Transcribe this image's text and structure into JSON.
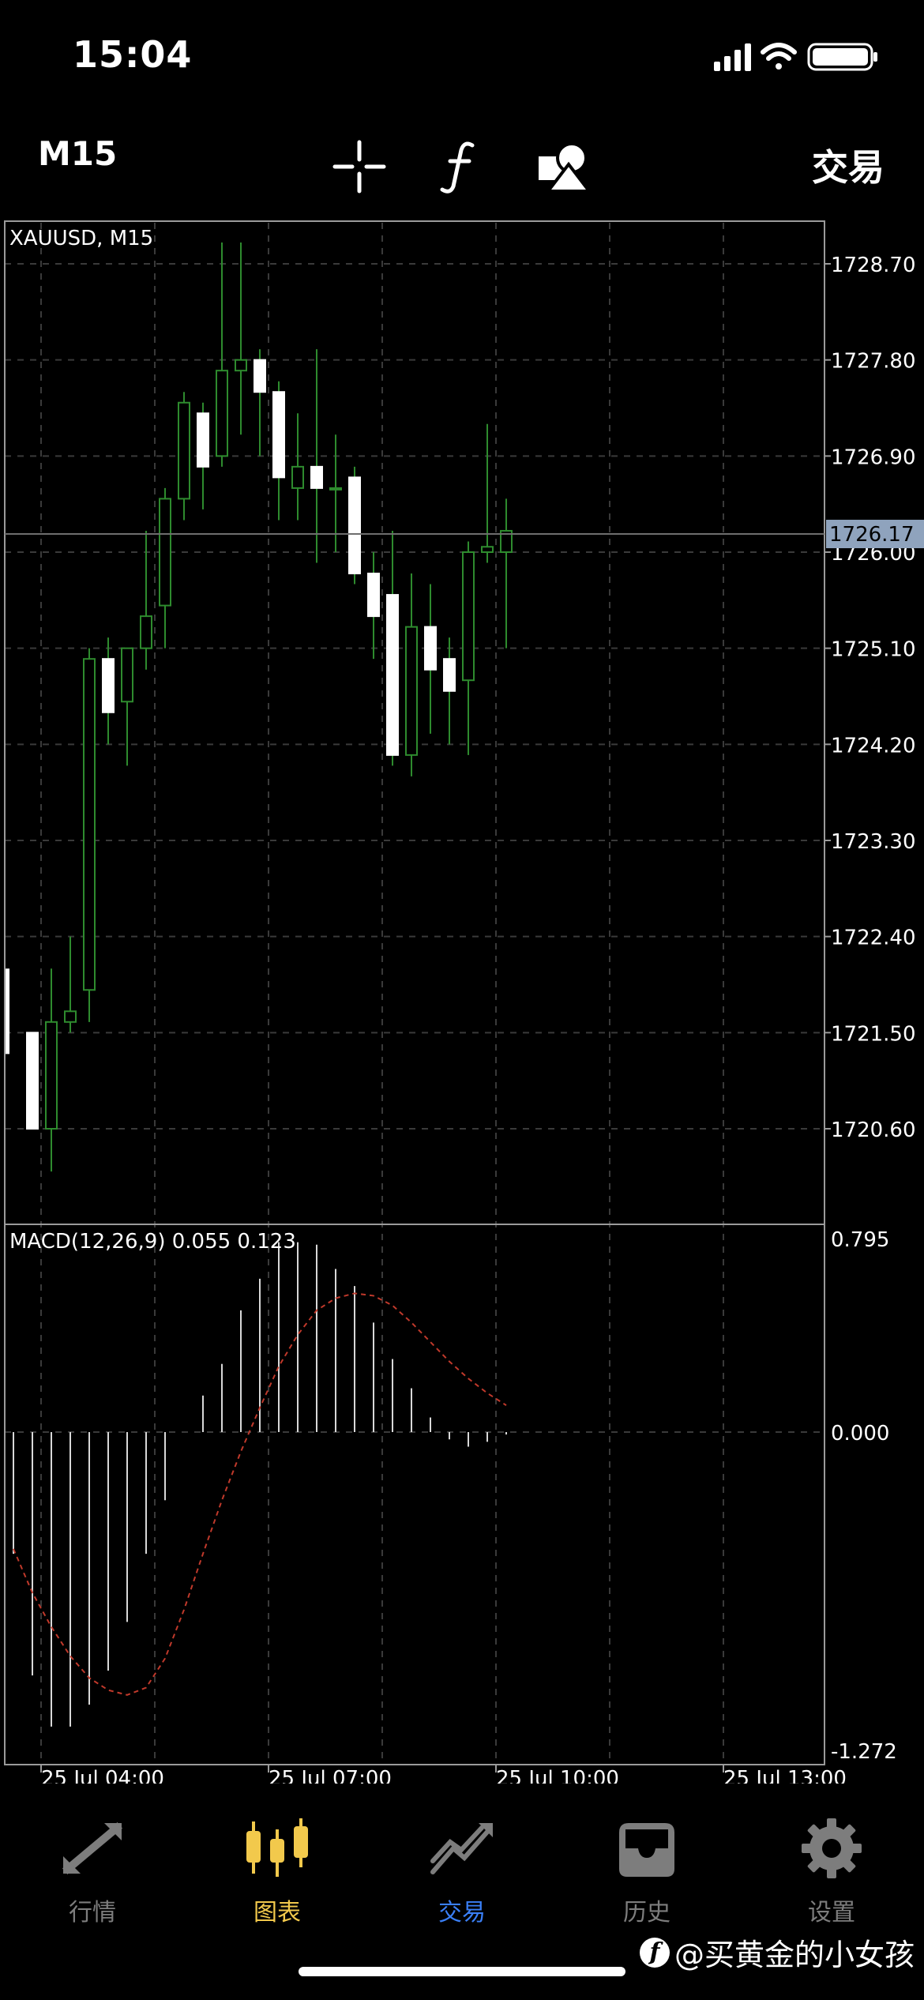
{
  "status": {
    "time": "15:04"
  },
  "toolbar": {
    "timeframe": "M15",
    "trade_label": "交易",
    "icons": [
      "crosshair-icon",
      "indicator-f-icon",
      "objects-icon"
    ]
  },
  "chart": {
    "symbol_label": "XAUUSD, M15",
    "current_price": "1726.17",
    "price_ticks": [
      "1728.70",
      "1727.80",
      "1726.90",
      "1726.00",
      "1725.10",
      "1724.20",
      "1723.30",
      "1722.40",
      "1721.50",
      "1720.60"
    ],
    "time_labels": [
      "25 Jul 04:00",
      "25 Jul 07:00",
      "25 Jul 10:00",
      "25 Jul 13:00"
    ],
    "macd_label": "MACD(12,26,9) 0.055 0.123",
    "macd_ticks": [
      "0.795",
      "0.000",
      "-1.272"
    ],
    "colors": {
      "bull": "#000000",
      "bear": "#ffffff",
      "wick": "#2e8b2e",
      "grid": "#3a3a3a",
      "signal": "#c0392b",
      "current_bg": "#8fa3bd"
    }
  },
  "chart_data": [
    {
      "type": "candlestick",
      "title": "XAUUSD, M15",
      "ylim": [
        1719.6,
        1729.1
      ],
      "candles": [
        {
          "o": 1721.5,
          "h": 1722.1,
          "l": 1721.3,
          "c": 1722.1
        },
        {
          "o": 1721.5,
          "h": 1721.5,
          "l": 1720.6,
          "c": 1720.6
        },
        {
          "o": 1720.6,
          "h": 1722.1,
          "l": 1720.2,
          "c": 1721.6
        },
        {
          "o": 1721.6,
          "h": 1722.4,
          "l": 1721.5,
          "c": 1721.7
        },
        {
          "o": 1721.9,
          "h": 1725.1,
          "l": 1721.6,
          "c": 1725.0
        },
        {
          "o": 1725.0,
          "h": 1725.2,
          "l": 1724.2,
          "c": 1724.5
        },
        {
          "o": 1724.6,
          "h": 1725.1,
          "l": 1724.0,
          "c": 1725.1
        },
        {
          "o": 1725.1,
          "h": 1726.2,
          "l": 1724.9,
          "c": 1725.4
        },
        {
          "o": 1725.5,
          "h": 1726.6,
          "l": 1725.1,
          "c": 1726.5
        },
        {
          "o": 1726.5,
          "h": 1727.5,
          "l": 1726.3,
          "c": 1727.4
        },
        {
          "o": 1727.3,
          "h": 1727.4,
          "l": 1726.4,
          "c": 1726.8
        },
        {
          "o": 1726.9,
          "h": 1728.9,
          "l": 1726.8,
          "c": 1727.7
        },
        {
          "o": 1727.7,
          "h": 1728.9,
          "l": 1727.1,
          "c": 1727.8
        },
        {
          "o": 1727.8,
          "h": 1727.9,
          "l": 1726.9,
          "c": 1727.5
        },
        {
          "o": 1727.5,
          "h": 1727.6,
          "l": 1726.3,
          "c": 1726.7
        },
        {
          "o": 1726.6,
          "h": 1727.3,
          "l": 1726.3,
          "c": 1726.8
        },
        {
          "o": 1726.8,
          "h": 1727.9,
          "l": 1725.9,
          "c": 1726.6
        },
        {
          "o": 1726.6,
          "h": 1727.1,
          "l": 1726.0,
          "c": 1726.6
        },
        {
          "o": 1726.7,
          "h": 1726.8,
          "l": 1725.7,
          "c": 1725.8
        },
        {
          "o": 1725.8,
          "h": 1726.0,
          "l": 1725.0,
          "c": 1725.4
        },
        {
          "o": 1725.6,
          "h": 1726.2,
          "l": 1724.0,
          "c": 1724.1
        },
        {
          "o": 1724.1,
          "h": 1725.8,
          "l": 1723.9,
          "c": 1725.3
        },
        {
          "o": 1725.3,
          "h": 1725.7,
          "l": 1724.3,
          "c": 1724.9
        },
        {
          "o": 1725.0,
          "h": 1725.2,
          "l": 1724.2,
          "c": 1724.7
        },
        {
          "o": 1724.8,
          "h": 1726.1,
          "l": 1724.1,
          "c": 1726.0
        },
        {
          "o": 1726.0,
          "h": 1727.2,
          "l": 1725.9,
          "c": 1726.05
        },
        {
          "o": 1726.0,
          "h": 1726.5,
          "l": 1725.1,
          "c": 1726.2
        }
      ]
    },
    {
      "type": "bar",
      "title": "MACD(12,26,9) 0.055 0.123",
      "ylim": [
        -1.272,
        0.795
      ],
      "histogram": [
        -0.5,
        -1.0,
        -1.21,
        -1.21,
        -1.12,
        -0.98,
        -0.78,
        -0.5,
        -0.28,
        0.0,
        0.15,
        0.28,
        0.5,
        0.63,
        0.78,
        0.78,
        0.77,
        0.67,
        0.6,
        0.45,
        0.3,
        0.18,
        0.06,
        -0.03,
        -0.06,
        -0.04,
        -0.01
      ],
      "signal": [
        -0.48,
        -0.66,
        -0.8,
        -0.92,
        -1.01,
        -1.06,
        -1.08,
        -1.05,
        -0.93,
        -0.73,
        -0.5,
        -0.28,
        -0.08,
        0.1,
        0.27,
        0.4,
        0.5,
        0.55,
        0.57,
        0.56,
        0.52,
        0.45,
        0.37,
        0.29,
        0.22,
        0.16,
        0.11
      ]
    }
  ],
  "tabs": [
    {
      "label": "行情",
      "icon": "quotes-icon"
    },
    {
      "label": "图表",
      "icon": "chart-candles-icon"
    },
    {
      "label": "交易",
      "icon": "trade-icon"
    },
    {
      "label": "历史",
      "icon": "history-tray-icon"
    },
    {
      "label": "设置",
      "icon": "settings-gear-icon"
    }
  ],
  "watermark": {
    "text": "@买黄金的小女孩",
    "logo": "f"
  }
}
